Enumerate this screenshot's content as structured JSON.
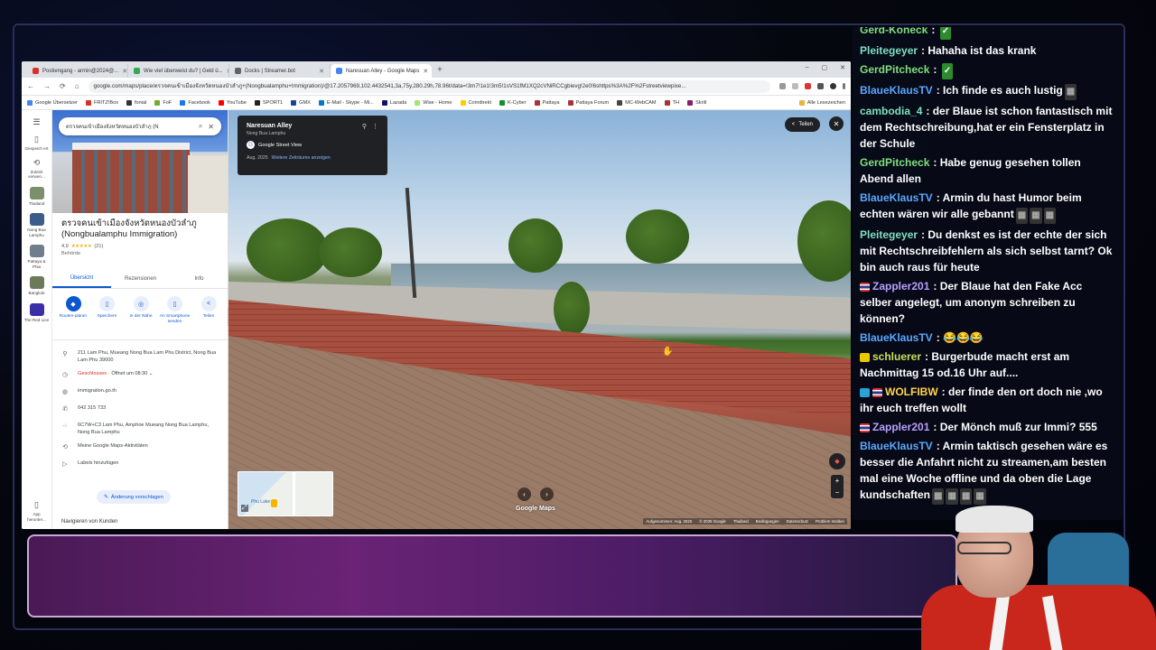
{
  "browser": {
    "tabs": [
      {
        "label": "Postiengang - armin@2024@...",
        "color": "#d93025"
      },
      {
        "label": "Wie viel überweist du? | Geld ü...",
        "color": "#34a853"
      },
      {
        "label": "Docks | Streamer.bot",
        "color": "#5f6368"
      },
      {
        "label": "Naresuan Alley - Google Maps",
        "color": "#4285f4",
        "active": true
      }
    ],
    "new_tab": "+",
    "window_controls": [
      "–",
      "▢",
      "✕"
    ],
    "url": "google.com/maps/place/ตรวจคนเข้าเมืองจังหวัดหนองบัวลำภู+(Nongbualamphu+Immigration)/@17.2057969,102.4432541,3a,75y,280.29h,78.96t/data=!3m7!1e1!3m5!1sVS1fM1XQ2cVNiRCCgbievg!2e0!6shttps%3A%2F%2Fstreetviewpixe...",
    "bookmarks": [
      {
        "label": "Google Übersetzer",
        "color": "#4285f4"
      },
      {
        "label": "FRITZ!Box",
        "color": "#d93025"
      },
      {
        "label": "fonial",
        "color": "#333"
      },
      {
        "label": "FoF",
        "color": "#7a3"
      },
      {
        "label": "Facebook",
        "color": "#1877f2"
      },
      {
        "label": "YouTube",
        "color": "#ff0000"
      },
      {
        "label": "SPORT1",
        "color": "#222"
      },
      {
        "label": "GMX",
        "color": "#1c449b"
      },
      {
        "label": "E-Mail - Skype - Mi...",
        "color": "#0078d4"
      },
      {
        "label": "Lazada",
        "color": "#0f146d"
      },
      {
        "label": "Wise - Home",
        "color": "#9fe870"
      },
      {
        "label": "Comdirekt",
        "color": "#fc0"
      },
      {
        "label": "K-Cyber",
        "color": "#138f2d"
      },
      {
        "label": "Pattaya",
        "color": "#a33"
      },
      {
        "label": "Pattaya Forum",
        "color": "#a33"
      },
      {
        "label": "MC-WebCAM",
        "color": "#444"
      },
      {
        "label": "TH",
        "color": "#a33"
      },
      {
        "label": "Skrill",
        "color": "#862165"
      }
    ],
    "bookmarks_all": "Alle Lesezeichen"
  },
  "maps": {
    "rail": [
      {
        "label": "Gespeich ert",
        "icon": "bookmark-icon",
        "glyph": "🔖"
      },
      {
        "label": "Zuletzt verwen...",
        "icon": "history-icon",
        "glyph": "⟲"
      },
      {
        "label": "Thailand",
        "thumb": "#7a8f6a"
      },
      {
        "label": "Nong Bua Lamphu",
        "thumb": "#3c5c8a"
      },
      {
        "label": "Pattaya & Phia",
        "thumb": "#6f7e8c"
      },
      {
        "label": "Bangkok",
        "thumb": "#6c7a5a"
      },
      {
        "label": "The Red Lion",
        "thumb": "#3b2fa8"
      }
    ],
    "rail_bottom": "App herunter...",
    "search_value": "ตรวจคนเข้าเมืองจังหวัดหนองบัวลำภู (N",
    "place": {
      "name": "ตรวจคนเข้าเมืองจังหวัดหนองบัวลำภู (Nongbualamphu Immigration)",
      "rating": "4,9",
      "stars": "★★★★★",
      "reviews": "(21)",
      "category": "Behörde"
    },
    "tabs": [
      "Übersicht",
      "Rezensionen",
      "Info"
    ],
    "actions": [
      {
        "label": "Routen-planer",
        "glyph": "◆",
        "primary": true
      },
      {
        "label": "Speichern",
        "glyph": "🔖"
      },
      {
        "label": "In der Nähe",
        "glyph": "◎"
      },
      {
        "label": "An Smartphone senden",
        "glyph": "▯"
      },
      {
        "label": "Teilen",
        "glyph": "<"
      }
    ],
    "info": {
      "address": "211 Lam Phu, Mueang Nong Bua Lam Phu District, Nong Bua Lam Phu 39000",
      "status_closed": "Geschlossen",
      "status_open": " · Öffnet um 08:30",
      "website": "immigration.go.th",
      "phone": "042 315 733",
      "pluscode": "6C7W+C3 Lam Phu, Amphoe Mueang Nong Bua Lamphu, Nong Bua Lamphu",
      "activity": "Meine Google Maps-Aktivitäten",
      "labels": "Labels hinzufügen"
    },
    "suggest": "Änderung vorschlagen",
    "more_results": "Navigieren von Kunden"
  },
  "streetview": {
    "title": "Naresuan Alley",
    "subtitle": "Nong Bua Lamphu",
    "brand": "Google Street View",
    "date": "Aug. 2025",
    "more_dates": "Weitere Zeiträume anzeigen",
    "share": "Teilen",
    "logo": "Google Maps",
    "minimap_label": "Phu Lake",
    "footer": [
      "Aufgenommen: Aug. 2025",
      "© 2026 Google",
      "Thailand",
      "Bedingungen",
      "Datenschutz",
      "Problem melden"
    ]
  },
  "chat": [
    {
      "user": "Gerd-Koneck",
      "color": "#7ee07e",
      "text": ""
    },
    {
      "user": "Pleitegeyer",
      "color": "#7ee0c0",
      "text": "Hahaha ist das krank"
    },
    {
      "user": "GerdPitcheck",
      "color": "#7ee07e",
      "text": ""
    },
    {
      "user": "BlaueKlausTV",
      "color": "#5aa8ff",
      "text": "Ich finde es auch lustig"
    },
    {
      "user": "cambodia_4",
      "color": "#7ee0c0",
      "text": "der Blaue ist schon fantastisch mit dem Rechtschreibung,hat er ein Fensterplatz in der Schule"
    },
    {
      "user": "GerdPitcheck",
      "color": "#7ee07e",
      "text": "Habe genug gesehen tollen Abend allen"
    },
    {
      "user": "BlaueKlausTV",
      "color": "#5aa8ff",
      "text": "Armin du hast Humor beim echten wären wir alle gebannt"
    },
    {
      "user": "Pleitegeyer",
      "color": "#7ee0c0",
      "text": "Du denkst es ist der echte der sich mit Rechtschreibfehlern als sich selbst tarnt? Ok bin auch raus für heute"
    },
    {
      "user": "Zappler201",
      "color": "#b8a0ff",
      "text": "Der Blaue hat den Fake Acc selber angelegt, um anonym schreiben zu können?"
    },
    {
      "user": "BlaueKlausTV",
      "color": "#5aa8ff",
      "text": "😂😂😂"
    },
    {
      "user": "schluerer",
      "color": "#c8e05a",
      "text": "Burgerbude macht erst am Nachmittag 15 od.16 Uhr auf...."
    },
    {
      "user": "WOLFIBW",
      "color": "#ffd54a",
      "text": "der finde den ort doch nie ,wo ihr euch treffen wollt"
    },
    {
      "user": "Zappler201",
      "color": "#b8a0ff",
      "text": "Der Mönch muß zur Immi? 555"
    },
    {
      "user": "BlaueKlausTV",
      "color": "#5aa8ff",
      "text": "Armin taktisch gesehen wäre es besser die Anfahrt nicht zu streamen,am besten mal eine Woche offline und da oben die Lage kundschaften"
    }
  ]
}
